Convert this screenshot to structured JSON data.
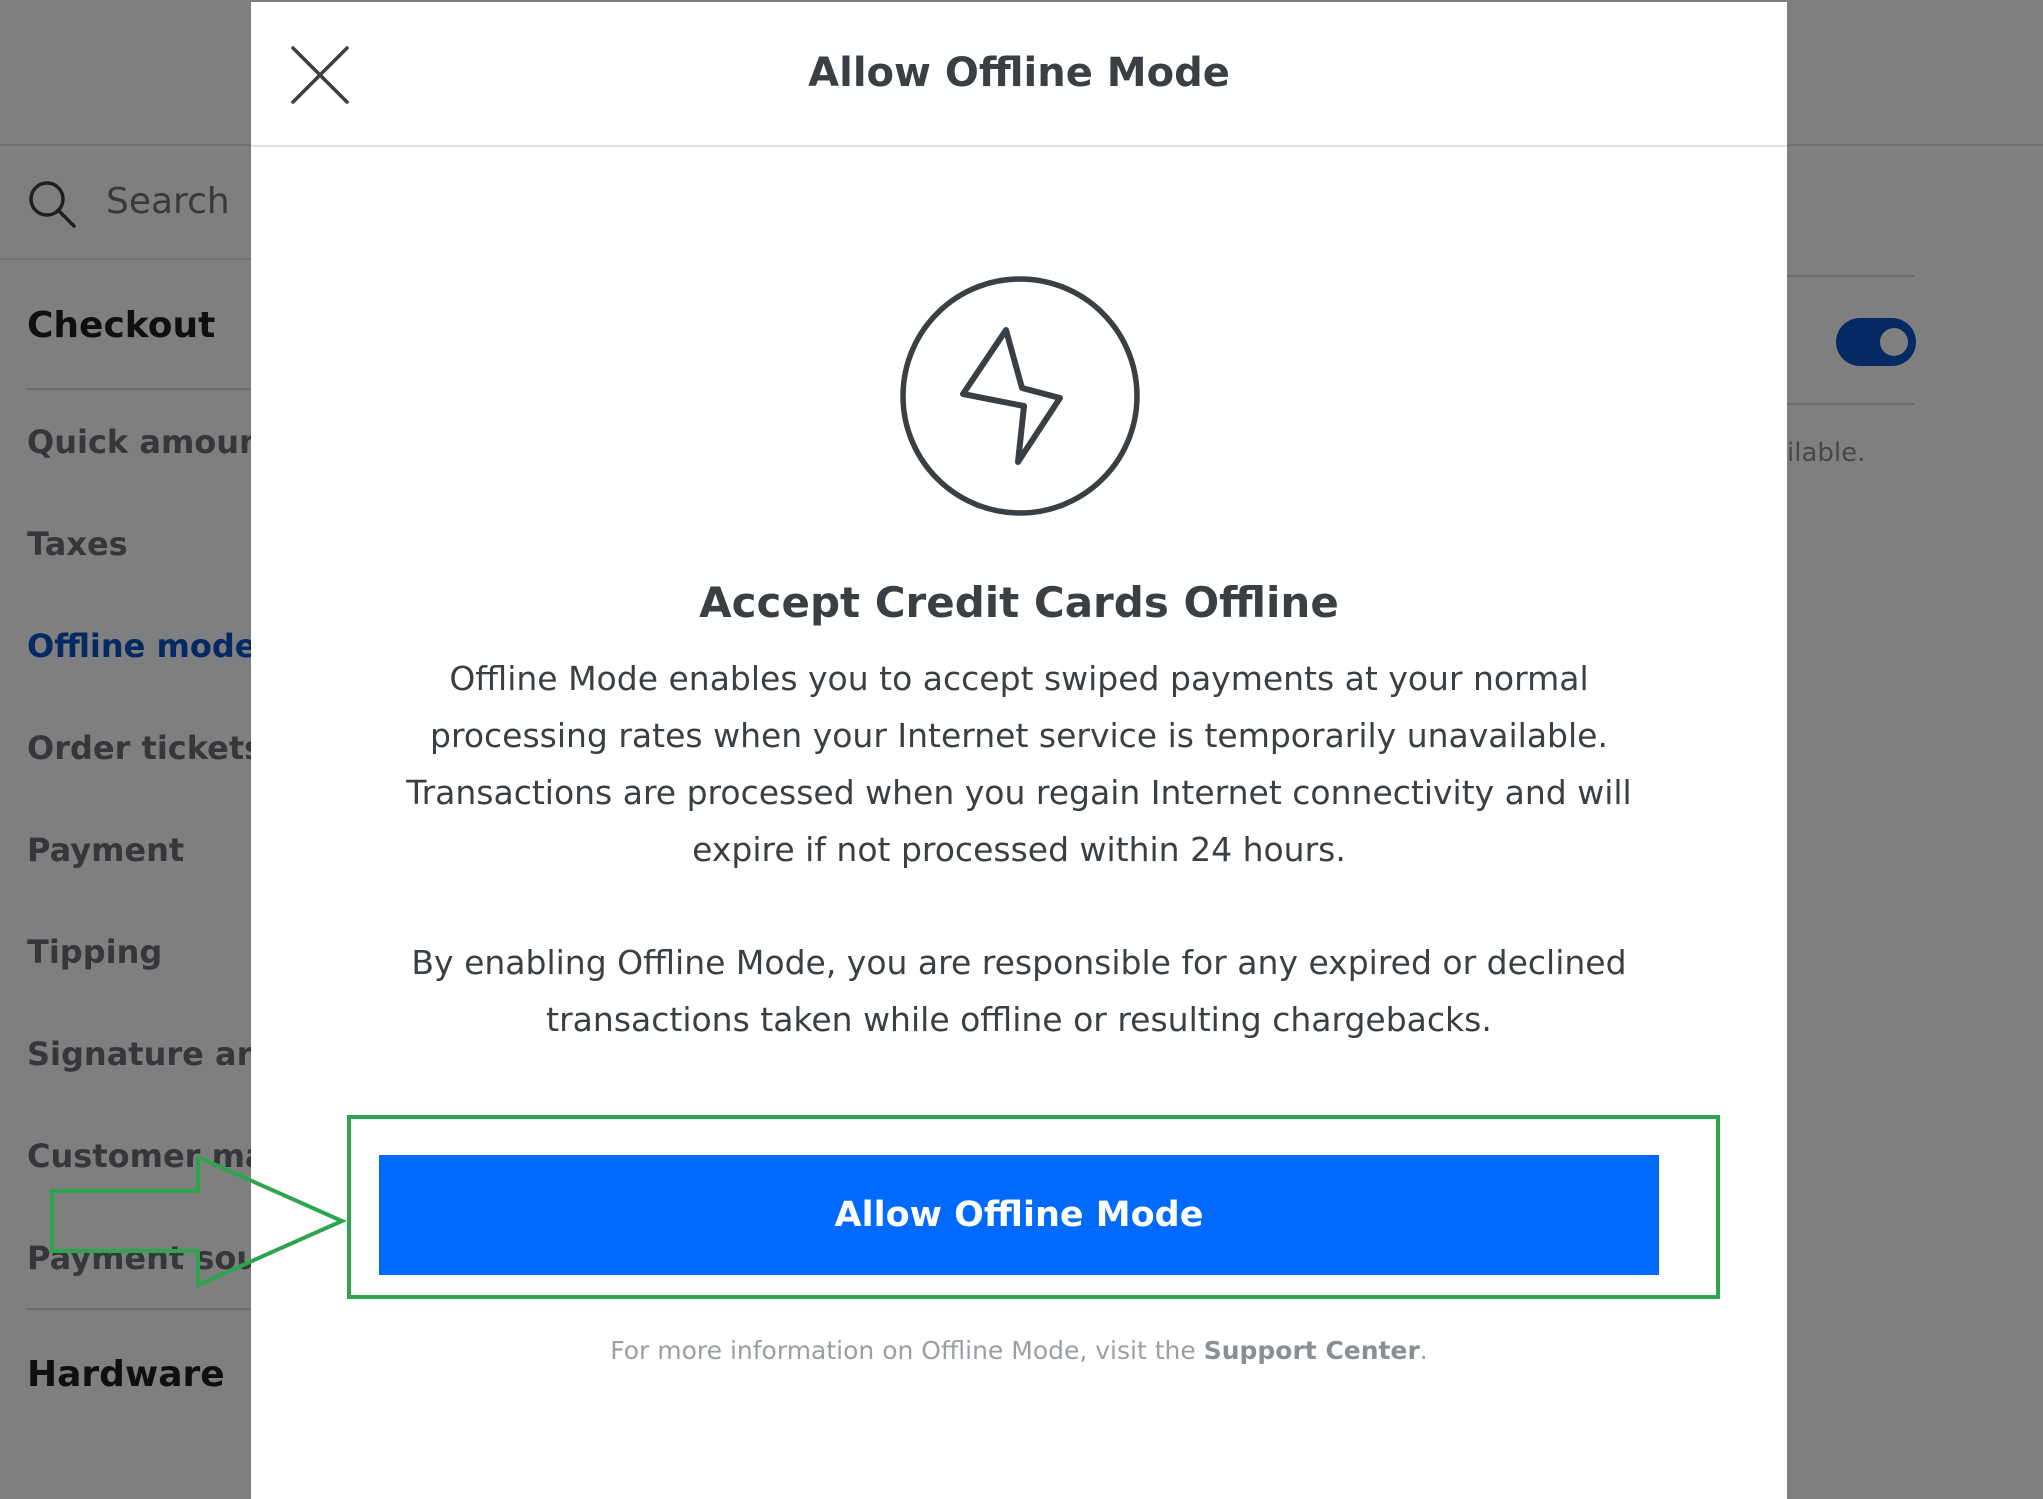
{
  "background": {
    "search": {
      "label": "Search"
    },
    "sidebar": {
      "section_checkout": "Checkout",
      "items": [
        {
          "label": "Quick amounts",
          "active": false
        },
        {
          "label": "Taxes",
          "active": false
        },
        {
          "label": "Offline mode",
          "active": true
        },
        {
          "label": "Order tickets",
          "active": false
        },
        {
          "label": "Payment",
          "active": false
        },
        {
          "label": "Tipping",
          "active": false
        },
        {
          "label": "Signature and",
          "active": false
        },
        {
          "label": "Customer man",
          "active": false
        },
        {
          "label": "Payment soun",
          "active": false
        }
      ],
      "section_hardware": "Hardware"
    },
    "right_panel": {
      "partial_text": "ilable.",
      "toggle_on": true
    }
  },
  "modal": {
    "title": "Allow Offline Mode",
    "headline": "Accept Credit Cards Offline",
    "paragraph_1": "Offline Mode enables you to accept swiped payments at your normal processing rates when your Internet service is temporarily unavailable. Transactions are processed when you regain Internet connectivity and will expire if not processed within 24 hours.",
    "paragraph_2": "By enabling Offline Mode, you are responsible for any expired or declined transactions taken while offline or resulting chargebacks.",
    "primary_button": "Allow Offline Mode",
    "footer": {
      "prefix": "For more information on Offline Mode, visit the ",
      "link": "Support Center",
      "suffix": "."
    }
  },
  "colors": {
    "accent": "#006aff",
    "active_nav": "#0a54c7",
    "annotation": "#2ea44f",
    "text": "#3a3f44"
  },
  "icons": [
    "search-icon",
    "close-icon",
    "lightning-bolt-icon",
    "arrow-annotation-icon"
  ]
}
